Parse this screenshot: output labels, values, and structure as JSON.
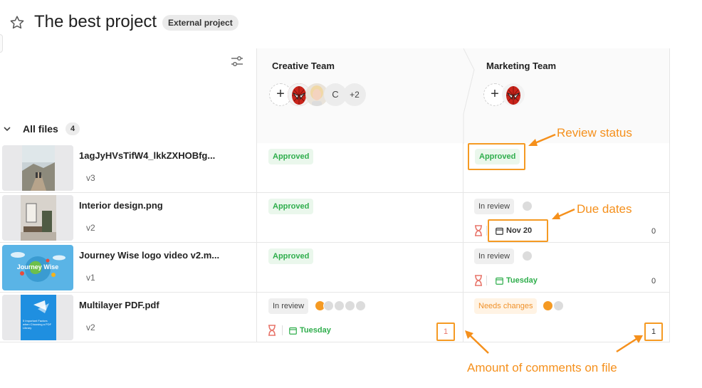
{
  "project": {
    "title": "The best project",
    "badge": "External project"
  },
  "teams": [
    {
      "name": "Creative Team",
      "extra_member_letter": "C",
      "more_count": "+2"
    },
    {
      "name": "Marketing Team"
    }
  ],
  "group": {
    "title": "All files",
    "count": "4"
  },
  "files": [
    {
      "name": "1agJyHVsTifW4_lkkZXHOBfg...",
      "version": "v3",
      "creative": {
        "status": "Approved"
      },
      "marketing": {
        "status": "Approved"
      }
    },
    {
      "name": "Interior design.png",
      "version": "v2",
      "creative": {
        "status": "Approved"
      },
      "marketing": {
        "status": "In review",
        "due": "Nov 20",
        "comments": "0"
      }
    },
    {
      "name": "Journey Wise logo video v2.m...",
      "version": "v1",
      "thumb_text": "Journey Wise",
      "creative": {
        "status": "Approved"
      },
      "marketing": {
        "status": "In review",
        "due": "Tuesday",
        "comments": "0"
      }
    },
    {
      "name": "Multilayer PDF.pdf",
      "version": "v2",
      "thumb_text": "5 Important Factors when Choosing a PDF Library",
      "creative": {
        "status": "In review",
        "due": "Tuesday",
        "comments": "1"
      },
      "marketing": {
        "status": "Needs changes",
        "comments": "1"
      }
    }
  ],
  "annotations": {
    "review_status": "Review status",
    "due_dates": "Due dates",
    "comments": "Amount of comments on file"
  },
  "colors": {
    "approved": "#2fae4c",
    "accent_orange": "#f59a23",
    "annotation": "#f5901c"
  }
}
